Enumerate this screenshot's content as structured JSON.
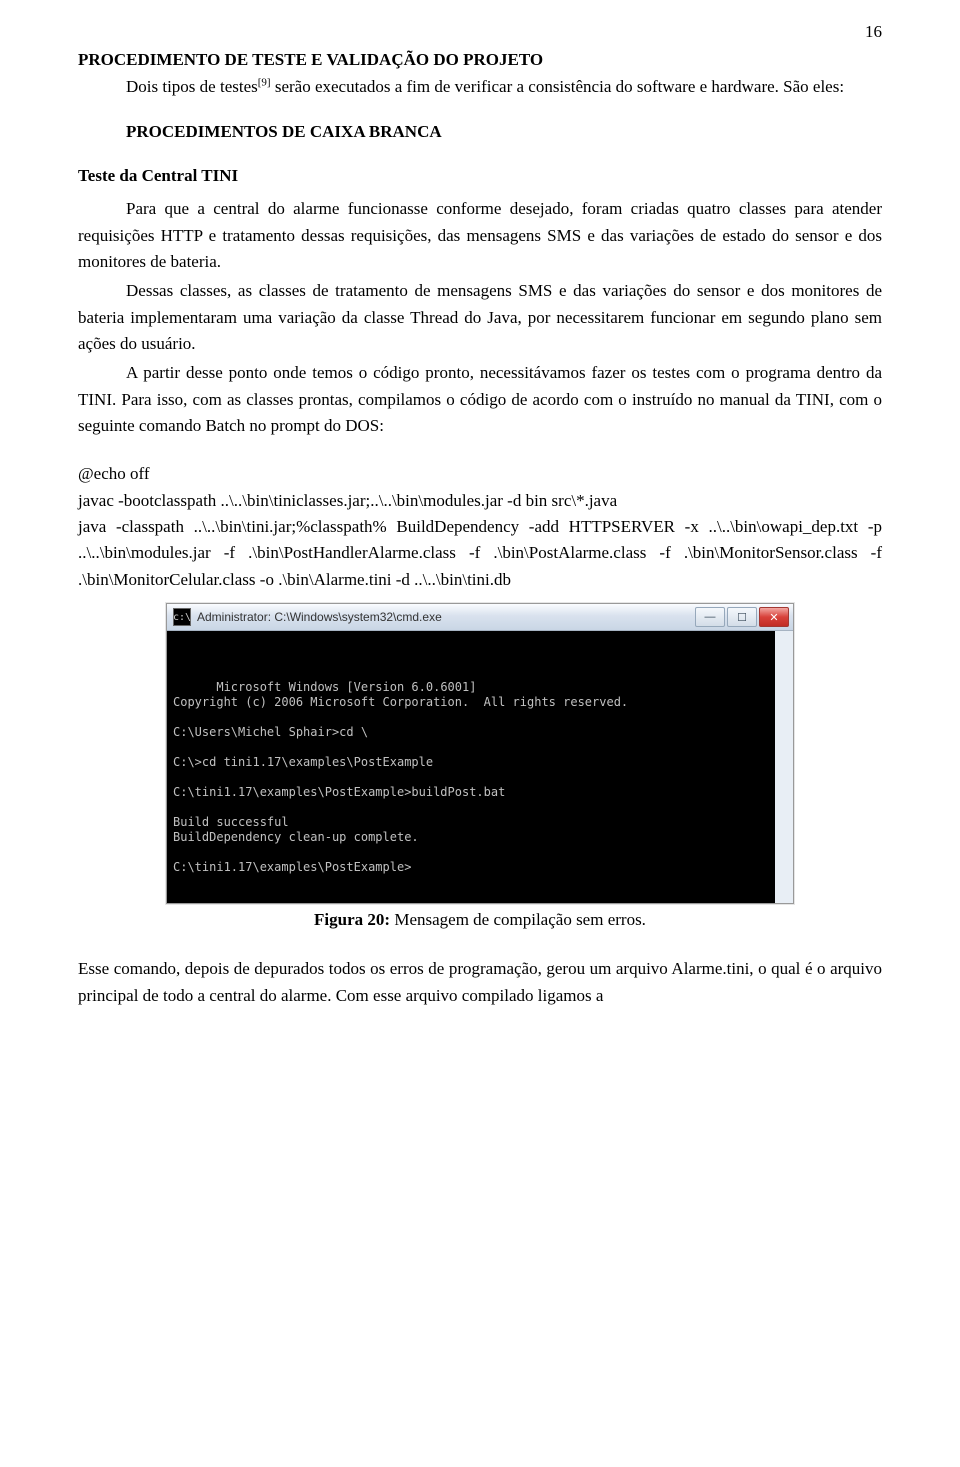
{
  "page_number": "16",
  "heading1": "PROCEDIMENTO DE TESTE E VALIDAÇÃO DO PROJETO",
  "intro_indent": "Dois tipos de testes",
  "intro_ref": "[9]",
  "intro_after": " serão executados a fim de verificar a consistência do software e hardware. São eles:",
  "heading2": "PROCEDIMENTOS DE CAIXA BRANCA",
  "heading3": "Teste da Central TINI",
  "para1": "Para que a central do alarme funcionasse conforme desejado, foram criadas quatro classes para atender requisições HTTP e tratamento dessas requisições, das mensagens SMS e das variações de estado do sensor e dos monitores de bateria.",
  "para2": "Dessas classes, as classes de tratamento de mensagens SMS e das variações do sensor e dos monitores de bateria implementaram uma variação da classe Thread do Java, por necessitarem funcionar em segundo plano sem ações do usuário.",
  "para3": "A partir desse ponto onde temos o código pronto, necessitávamos fazer os testes com o programa dentro da TINI. Para isso, com as classes prontas, compilamos o código de acordo com o instruído no manual da TINI, com o seguinte comando Batch no prompt do DOS:",
  "code_l1": "@echo off",
  "code_l2": "javac -bootclasspath ..\\..\\bin\\tiniclasses.jar;..\\..\\bin\\modules.jar -d bin src\\*.java",
  "code_l3": "java -classpath ..\\..\\bin\\tini.jar;%classpath% BuildDependency -add HTTPSERVER -x ..\\..\\bin\\owapi_dep.txt -p ..\\..\\bin\\modules.jar -f .\\bin\\PostHandlerAlarme.class -f .\\bin\\PostAlarme.class -f .\\bin\\MonitorSensor.class -f .\\bin\\MonitorCelular.class -o .\\bin\\Alarme.tini -d ..\\..\\bin\\tini.db",
  "cmd_title": "Administrator: C:\\Windows\\system32\\cmd.exe",
  "terminal_text": "Microsoft Windows [Version 6.0.6001]\nCopyright (c) 2006 Microsoft Corporation.  All rights reserved.\n\nC:\\Users\\Michel Sphair>cd \\\n\nC:\\>cd tini1.17\\examples\\PostExample\n\nC:\\tini1.17\\examples\\PostExample>buildPost.bat\n\nBuild successful\nBuildDependency clean-up complete.\n\nC:\\tini1.17\\examples\\PostExample>",
  "caption_bold": "Figura 20:",
  "caption_rest": " Mensagem de compilação sem erros.",
  "tail_para": "Esse comando, depois de depurados todos os erros de programação, gerou um arquivo Alarme.tini, o qual é o arquivo principal de todo a central do alarme. Com esse arquivo compilado ligamos a"
}
